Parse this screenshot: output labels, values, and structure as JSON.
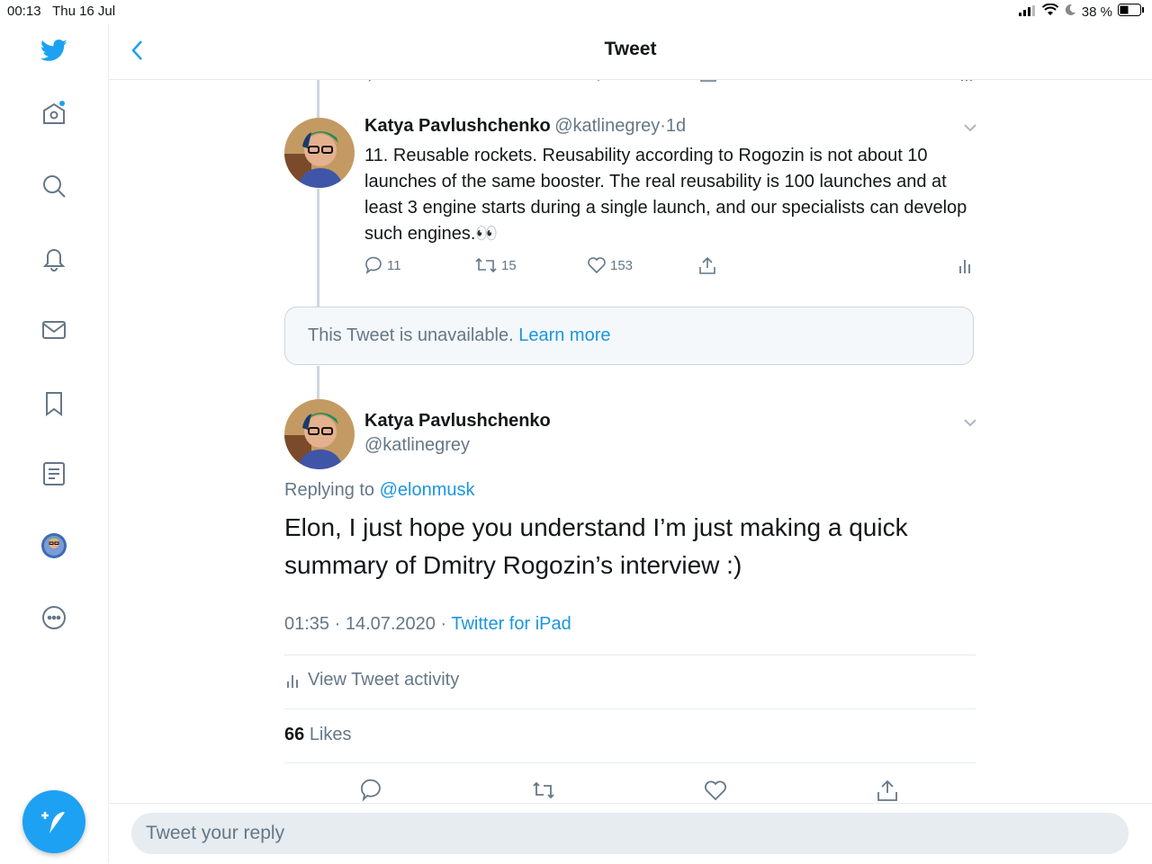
{
  "status_bar": {
    "time": "00:13",
    "date": "Thu 16 Jul",
    "battery": "38 %"
  },
  "header": {
    "title": "Tweet"
  },
  "thread_tweet": {
    "name": "Katya Pavlushchenko",
    "handle": "@katlinegrey",
    "separator": "·",
    "age": "1d",
    "text": "11. Reusable rockets. Reusability according to Rogozin is not about 10 launches of the same booster. The real reusability is 100 launches and at least 3 engine starts during a single launch, and our specialists can develop such engines.👀",
    "replies": "11",
    "retweets": "15",
    "likes": "153"
  },
  "unavailable": {
    "text": "This Tweet is unavailable.",
    "link": "Learn more"
  },
  "main_tweet": {
    "name": "Katya Pavlushchenko",
    "handle": "@katlinegrey",
    "replying_prefix": "Replying to",
    "replying_to": "@elonmusk",
    "text": "Elon, I just hope you understand I’m just making a quick summary of Dmitry Rogozin’s interview :)",
    "timestamp": "01:35 · 14.07.2020 ·",
    "source": "Twitter for iPad",
    "activity_label": "View Tweet activity",
    "likes_count": "66",
    "likes_label": "Likes"
  },
  "reply": {
    "placeholder": "Tweet your reply"
  },
  "colors": {
    "accent": "#1da1f2",
    "link": "#1b95e0",
    "muted": "#657786"
  }
}
